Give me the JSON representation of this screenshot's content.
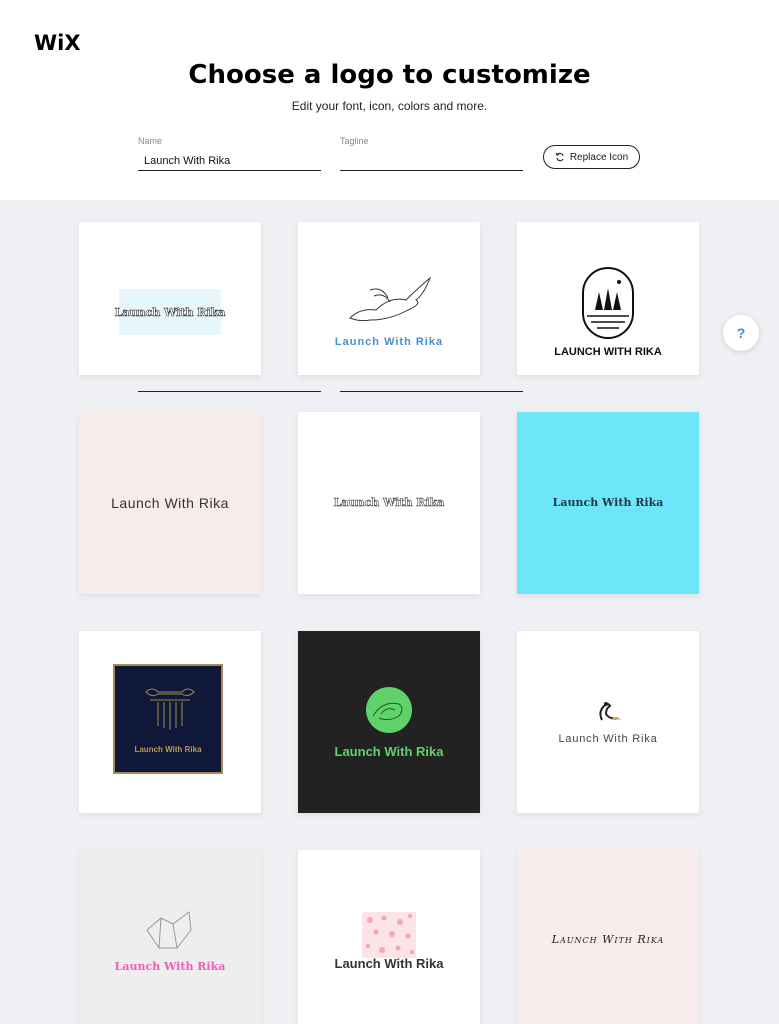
{
  "brand": {
    "logo_text": "WiX"
  },
  "header": {
    "title": "Choose a logo to customize",
    "subtitle": "Edit your font, icon, colors and more."
  },
  "form": {
    "name_label": "Name",
    "name_value": "Launch With Rika",
    "tagline_label": "Tagline",
    "tagline_value": "",
    "replace_icon_label": "Replace Icon"
  },
  "help": {
    "label": "?"
  },
  "logos": [
    {
      "text": "Launch With Rika",
      "background": "#ffffff",
      "text_color": "#333333",
      "icon": "none"
    },
    {
      "text": "Launch With Rika",
      "background": "#ffffff",
      "text_color": "#4a8fc7",
      "icon": "bird-outline-icon"
    },
    {
      "text": "LAUNCH WITH RIKA",
      "background": "#ffffff",
      "text_color": "#111111",
      "icon": "forest-badge-icon"
    },
    {
      "text": "Launch With Rika",
      "background": "#f7ebeb",
      "text_color": "#333333",
      "icon": "none"
    },
    {
      "text": "Launch With Rika",
      "background": "#ffffff",
      "text_color": "#444444",
      "icon": "none"
    },
    {
      "text": "Launch With Rika",
      "background": "#6ee6fa",
      "text_color": "#1c3a44",
      "icon": "none"
    },
    {
      "text": "Launch With Rika",
      "background": "#ffffff",
      "text_color": "#b89a5a",
      "icon": "column-capital-icon"
    },
    {
      "text": "Launch With Rika",
      "background": "#222222",
      "text_color": "#5fd36a",
      "icon": "green-circle-emblem-icon"
    },
    {
      "text": "Launch With Rika",
      "background": "#ffffff",
      "text_color": "#444444",
      "icon": "dove-icon"
    },
    {
      "text": "Launch With Rika",
      "background": "#eeeeee",
      "text_color": "#ec5fb7",
      "icon": "geometric-shape-icon"
    },
    {
      "text": "Launch With Rika",
      "background": "#ffffff",
      "text_color": "#333333",
      "icon": "pink-pattern-icon"
    },
    {
      "text": "Launch With Rika",
      "background": "#f7ebeb",
      "text_color": "#222222",
      "icon": "none"
    }
  ]
}
